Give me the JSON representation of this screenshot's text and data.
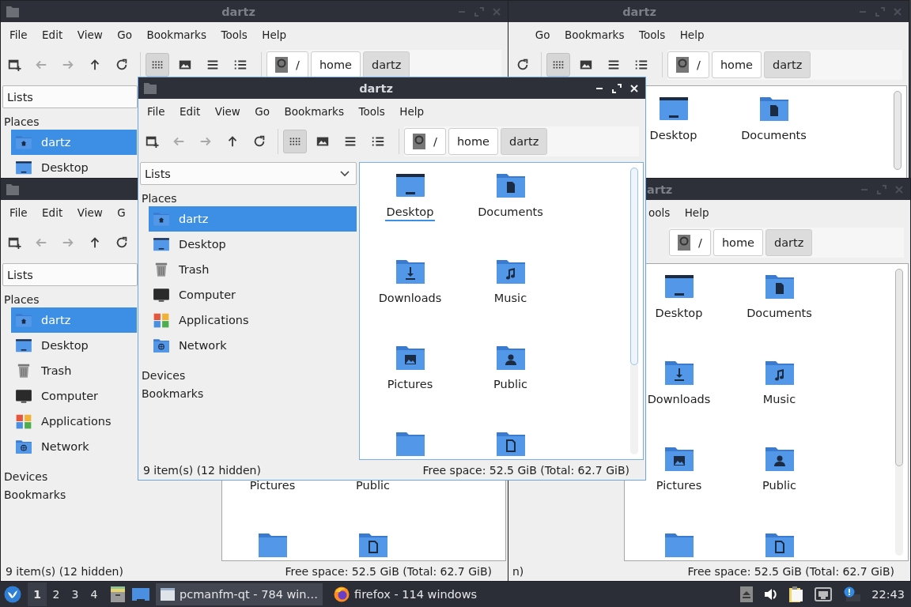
{
  "windows": [
    {
      "active": false,
      "title": "dartz",
      "menu": [
        "File",
        "Edit",
        "View",
        "Go",
        "Bookmarks",
        "Tools",
        "Help"
      ],
      "toolbar": {
        "nav": [
          {
            "kind": "new-window",
            "disabled": false
          },
          {
            "kind": "back",
            "disabled": true
          },
          {
            "kind": "forward",
            "disabled": true
          },
          {
            "kind": "up",
            "disabled": false
          },
          {
            "kind": "reload",
            "disabled": false
          }
        ],
        "views": [
          {
            "kind": "icons",
            "selected": true
          },
          {
            "kind": "thumbnails",
            "selected": false
          },
          {
            "kind": "compact",
            "selected": false
          },
          {
            "kind": "detailed",
            "selected": false
          }
        ],
        "path": [
          {
            "kind": "root",
            "label": "/",
            "selected": false
          },
          {
            "kind": "folder",
            "label": "home",
            "selected": false
          },
          {
            "kind": "folder",
            "label": "dartz",
            "selected": true
          }
        ]
      },
      "sidebar": {
        "combo": "Lists",
        "places_heading": "Places",
        "places": [
          {
            "kind": "home",
            "label": "dartz",
            "selected": true
          },
          {
            "kind": "desktop",
            "label": "Desktop",
            "selected": false
          }
        ]
      }
    },
    {
      "active": false,
      "title": "dartz",
      "menu": [
        "Go",
        "Bookmarks",
        "Tools",
        "Help"
      ],
      "toolbar": {
        "nav": [
          {
            "kind": "reload",
            "disabled": false
          }
        ],
        "views": [
          {
            "kind": "icons",
            "selected": true
          },
          {
            "kind": "thumbnails",
            "selected": false
          },
          {
            "kind": "compact",
            "selected": false
          },
          {
            "kind": "detailed",
            "selected": false
          }
        ],
        "path": [
          {
            "kind": "root",
            "label": "/",
            "selected": false
          },
          {
            "kind": "folder",
            "label": "home",
            "selected": false
          },
          {
            "kind": "folder",
            "label": "dartz",
            "selected": true
          }
        ]
      },
      "files": [
        {
          "kind": "desktop",
          "label": "Desktop"
        },
        {
          "kind": "documents",
          "label": "Documents"
        }
      ]
    },
    {
      "active": false,
      "menu": [
        "File",
        "Edit",
        "View",
        "G"
      ],
      "toolbar": {
        "nav": [
          {
            "kind": "new-window",
            "disabled": false
          },
          {
            "kind": "back",
            "disabled": true
          },
          {
            "kind": "forward",
            "disabled": true
          },
          {
            "kind": "up",
            "disabled": false
          },
          {
            "kind": "reload",
            "disabled": false
          }
        ]
      },
      "sidebar": {
        "combo": "Lists",
        "places_heading": "Places",
        "places": [
          {
            "kind": "home",
            "label": "dartz",
            "selected": true
          },
          {
            "kind": "desktop",
            "label": "Desktop",
            "selected": false
          },
          {
            "kind": "trash",
            "label": "Trash",
            "selected": false
          },
          {
            "kind": "computer",
            "label": "Computer",
            "selected": false
          },
          {
            "kind": "applications",
            "label": "Applications",
            "selected": false
          },
          {
            "kind": "network",
            "label": "Network",
            "selected": false
          }
        ],
        "devices_heading": "Devices",
        "bookmarks_heading": "Bookmarks"
      },
      "files": [
        {
          "label": "Pictures"
        },
        {
          "label": "Public"
        },
        {
          "kind": "plain"
        },
        {
          "kind": "templates"
        }
      ],
      "status": {
        "left": "9 item(s) (12 hidden)",
        "right": "Free space: 52.5 GiB (Total: 62.7 GiB)"
      }
    },
    {
      "active": false,
      "title": "artz",
      "menu": [
        "ools",
        "Help"
      ],
      "toolbar": {
        "path": [
          {
            "kind": "root",
            "label": "/",
            "selected": false
          },
          {
            "kind": "folder",
            "label": "home",
            "selected": false
          },
          {
            "kind": "folder",
            "label": "dartz",
            "selected": true
          }
        ]
      },
      "files": [
        {
          "kind": "desktop",
          "label": "Desktop"
        },
        {
          "kind": "documents",
          "label": "Documents"
        },
        {
          "kind": "downloads",
          "label": "Downloads"
        },
        {
          "kind": "music",
          "label": "Music"
        },
        {
          "kind": "pictures",
          "label": "Pictures"
        },
        {
          "kind": "public",
          "label": "Public"
        },
        {
          "kind": "plain"
        },
        {
          "kind": "templates"
        }
      ],
      "status": {
        "left": "n)",
        "right": "Free space: 52.5 GiB (Total: 62.7 GiB)"
      }
    },
    {
      "active": true,
      "title": "dartz",
      "menu": [
        "File",
        "Edit",
        "View",
        "Go",
        "Bookmarks",
        "Tools",
        "Help"
      ],
      "toolbar": {
        "nav": [
          {
            "kind": "new-window",
            "disabled": false
          },
          {
            "kind": "back",
            "disabled": true
          },
          {
            "kind": "forward",
            "disabled": true
          },
          {
            "kind": "up",
            "disabled": false
          },
          {
            "kind": "reload",
            "disabled": false
          }
        ],
        "views": [
          {
            "kind": "icons",
            "selected": true
          },
          {
            "kind": "thumbnails",
            "selected": false
          },
          {
            "kind": "compact",
            "selected": false
          },
          {
            "kind": "detailed",
            "selected": false
          }
        ],
        "path": [
          {
            "kind": "root",
            "label": "/",
            "selected": false
          },
          {
            "kind": "folder",
            "label": "home",
            "selected": false
          },
          {
            "kind": "folder",
            "label": "dartz",
            "selected": true
          }
        ]
      },
      "sidebar": {
        "combo": "Lists",
        "places_heading": "Places",
        "places": [
          {
            "kind": "home",
            "label": "dartz",
            "selected": true
          },
          {
            "kind": "desktop",
            "label": "Desktop",
            "selected": false
          },
          {
            "kind": "trash",
            "label": "Trash",
            "selected": false
          },
          {
            "kind": "computer",
            "label": "Computer",
            "selected": false
          },
          {
            "kind": "applications",
            "label": "Applications",
            "selected": false
          },
          {
            "kind": "network",
            "label": "Network",
            "selected": false
          }
        ],
        "devices_heading": "Devices",
        "bookmarks_heading": "Bookmarks"
      },
      "files": [
        {
          "kind": "desktop",
          "label": "Desktop",
          "selected": true
        },
        {
          "kind": "documents",
          "label": "Documents",
          "selected": false
        },
        {
          "kind": "downloads",
          "label": "Downloads",
          "selected": false
        },
        {
          "kind": "music",
          "label": "Music",
          "selected": false
        },
        {
          "kind": "pictures",
          "label": "Pictures",
          "selected": false
        },
        {
          "kind": "public",
          "label": "Public",
          "selected": false
        },
        {
          "kind": "plain",
          "selected": false
        },
        {
          "kind": "templates",
          "selected": false
        }
      ],
      "status": {
        "left": "9 item(s) (12 hidden)",
        "right": "Free space: 52.5 GiB (Total: 62.7 GiB)"
      }
    }
  ],
  "taskbar": {
    "desktops": [
      {
        "label": "1",
        "selected": true
      },
      {
        "label": "2",
        "selected": false
      },
      {
        "label": "3",
        "selected": false
      },
      {
        "label": "4",
        "selected": false
      }
    ],
    "tasks": [
      {
        "kind": "file-manager",
        "label": "pcmanfm-qt - 784 win…",
        "selected": true
      },
      {
        "kind": "web-browser",
        "label": "firefox - 114 windows",
        "selected": false
      }
    ],
    "clock": "22:43"
  }
}
